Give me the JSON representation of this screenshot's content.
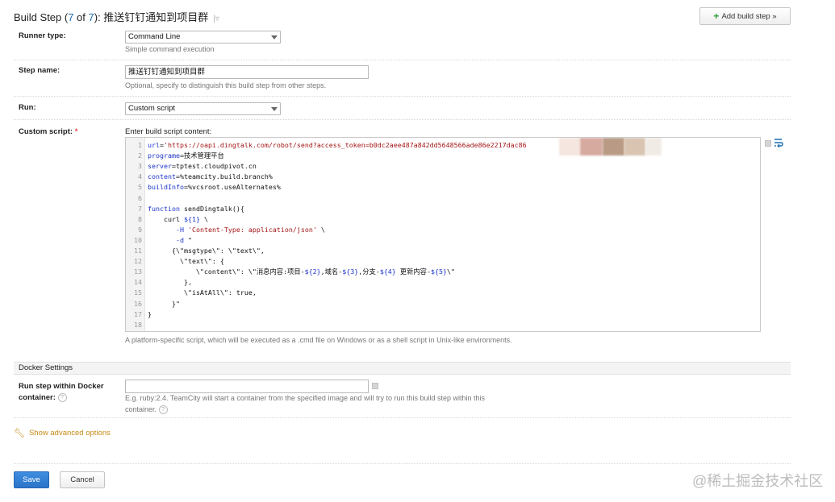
{
  "header": {
    "title_prefix": "Build Step (",
    "step_current": "7",
    "step_of": " of ",
    "step_total": "7",
    "title_suffix": "): 推送钉钉通知到项目群",
    "title_dropdown": "|▿",
    "add_build_step": "Add build step »"
  },
  "runner": {
    "label": "Runner type:",
    "value": "Command Line",
    "note": "Simple command execution"
  },
  "step_name": {
    "label": "Step name:",
    "value": "推送钉钉通知到项目群",
    "note": "Optional, specify to distinguish this build step from other steps."
  },
  "run": {
    "label": "Run:",
    "value": "Custom script"
  },
  "custom_script": {
    "label": "Custom script:",
    "required_mark": "*",
    "hint": "Enter build script content:",
    "lines": [
      {
        "n": "1",
        "text": "url='https://oapi.dingtalk.com/robot/send?access_token=b0dc2aee487a842dd5648566ade86e2217dac86                    8'"
      },
      {
        "n": "2",
        "text": "programe=技术管理平台"
      },
      {
        "n": "3",
        "text": "server=tptest.cloudpivot.cn"
      },
      {
        "n": "4",
        "text": "content=%teamcity.build.branch%"
      },
      {
        "n": "5",
        "text": "buildInfo=%vcsroot.useAlternates%"
      },
      {
        "n": "6",
        "text": ""
      },
      {
        "n": "7",
        "text": "function sendDingtalk(){"
      },
      {
        "n": "8",
        "text": "    curl ${1} \\"
      },
      {
        "n": "9",
        "text": "       -H 'Content-Type: application/json' \\"
      },
      {
        "n": "10",
        "text": "       -d \""
      },
      {
        "n": "11",
        "text": "      {\\\"msgtype\\\": \\\"text\\\","
      },
      {
        "n": "12",
        "text": "        \\\"text\\\": {"
      },
      {
        "n": "13",
        "text": "            \\\"content\\\": \\\"消息内容:项目-${2},域名-${3},分支-${4} 更新内容-${5}\\\""
      },
      {
        "n": "14",
        "text": "         },"
      },
      {
        "n": "15",
        "text": "         \\\"isAtAll\\\": true,"
      },
      {
        "n": "16",
        "text": "      }\""
      },
      {
        "n": "17",
        "text": "}"
      },
      {
        "n": "18",
        "text": ""
      }
    ],
    "note": "A platform-specific script, which will be executed as a .cmd file on Windows or as a shell script in Unix-like environments."
  },
  "docker": {
    "section_title": "Docker Settings",
    "label": "Run step within Docker container:",
    "value": "",
    "note": "E.g. ruby:2.4. TeamCity will start a container from the specified image and will try to run this build step within this container.",
    "help": "?"
  },
  "advanced": {
    "label": "Show advanced options"
  },
  "footer": {
    "save": "Save",
    "cancel": "Cancel"
  },
  "watermark": "@稀土掘金技术社区",
  "icons": [
    "plus-icon",
    "dropdown-arrow-icon",
    "wrap-lines-icon",
    "help-icon",
    "wrench-icon"
  ],
  "colors": {
    "link": "#1a6fb3",
    "save_button": "#2c74c9",
    "advanced_link": "#c58a17",
    "required": "#e04848"
  }
}
